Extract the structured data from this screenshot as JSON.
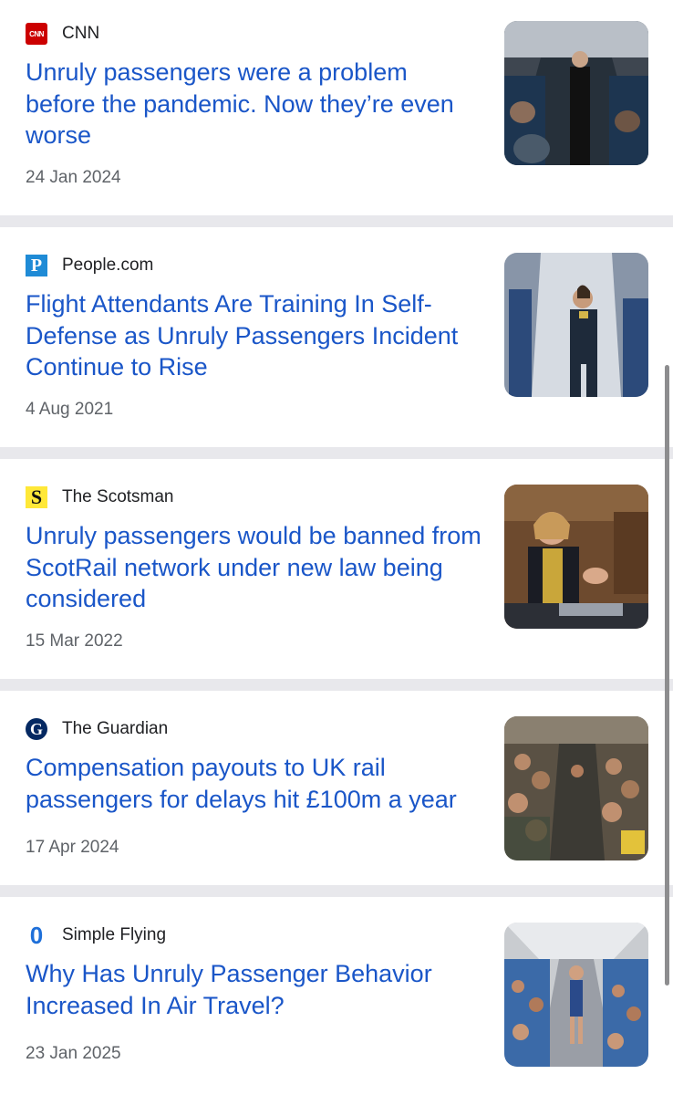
{
  "articles": [
    {
      "source": "CNN",
      "source_logo": "cnn-logo-icon",
      "headline": "Unruly passengers were a problem before the pandemic. Now they’re even worse",
      "date": "24 Jan 2024",
      "thumbnail": "aircraft-cabin-flight-attendant-photo"
    },
    {
      "source": "People.com",
      "source_logo": "people-logo-icon",
      "headline": "Flight Attendants Are Training In Self-Defense as Unruly Passengers Incident Continue to Rise",
      "date": "4 Aug 2021",
      "thumbnail": "flight-attendant-aisle-photo"
    },
    {
      "source": "The Scotsman",
      "source_logo": "scotsman-logo-icon",
      "headline": "Unruly passengers would be banned from ScotRail network under new law being considered",
      "date": "15 Mar 2022",
      "thumbnail": "parliament-speaker-photo"
    },
    {
      "source": "The Guardian",
      "source_logo": "guardian-logo-icon",
      "headline": "Compensation payouts to UK rail passengers for delays hit £100m a year",
      "date": "17 Apr 2024",
      "thumbnail": "crowded-rail-carriage-photo"
    },
    {
      "source": "Simple Flying",
      "source_logo": "simple-flying-logo-icon",
      "headline": "Why Has Unruly Passenger Behavior Increased In Air Travel?",
      "date": "23 Jan 2025",
      "thumbnail": "crowded-aircraft-cabin-photo"
    }
  ],
  "logo_glyphs": {
    "cnn": "CNN",
    "people": "P",
    "scotsman": "S",
    "guardian": "G",
    "simple_flying": "0"
  },
  "colors": {
    "headline": "#1a56c8",
    "source": "#202124",
    "date": "#5f6368",
    "divider": "#e8e8ec"
  }
}
